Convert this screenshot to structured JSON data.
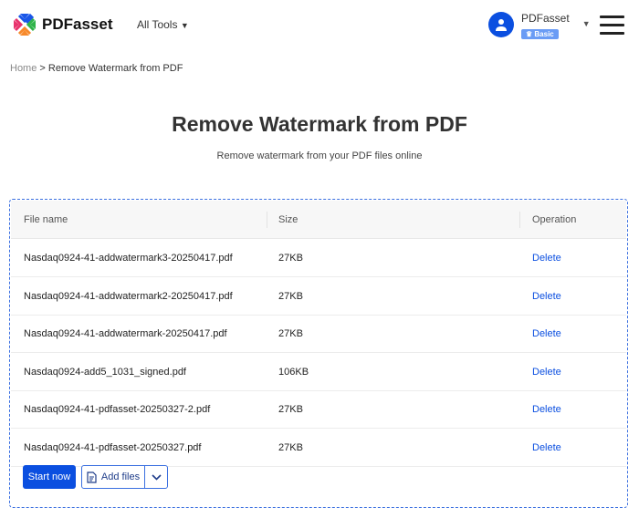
{
  "header": {
    "brand": "PDFasset",
    "all_tools": "All Tools",
    "user_name": "PDFasset",
    "plan_badge": "Basic"
  },
  "breadcrumb": {
    "home": "Home",
    "separator": ">",
    "current": "Remove Watermark from PDF"
  },
  "page": {
    "title": "Remove Watermark from PDF",
    "subtitle": "Remove watermark from your PDF files online"
  },
  "table": {
    "headers": [
      "File name",
      "Size",
      "Operation"
    ],
    "rows": [
      {
        "name": "Nasdaq0924-41-addwatermark3-20250417.pdf",
        "size": "27KB",
        "op": "Delete"
      },
      {
        "name": "Nasdaq0924-41-addwatermark2-20250417.pdf",
        "size": "27KB",
        "op": "Delete"
      },
      {
        "name": "Nasdaq0924-41-addwatermark-20250417.pdf",
        "size": "27KB",
        "op": "Delete"
      },
      {
        "name": "Nasdaq0924-add5_1031_signed.pdf",
        "size": "106KB",
        "op": "Delete"
      },
      {
        "name": "Nasdaq0924-41-pdfasset-20250327-2.pdf",
        "size": "27KB",
        "op": "Delete"
      },
      {
        "name": "Nasdaq0924-41-pdfasset-20250327.pdf",
        "size": "27KB",
        "op": "Delete"
      }
    ]
  },
  "actions": {
    "start": "Start now",
    "add": "Add files"
  }
}
